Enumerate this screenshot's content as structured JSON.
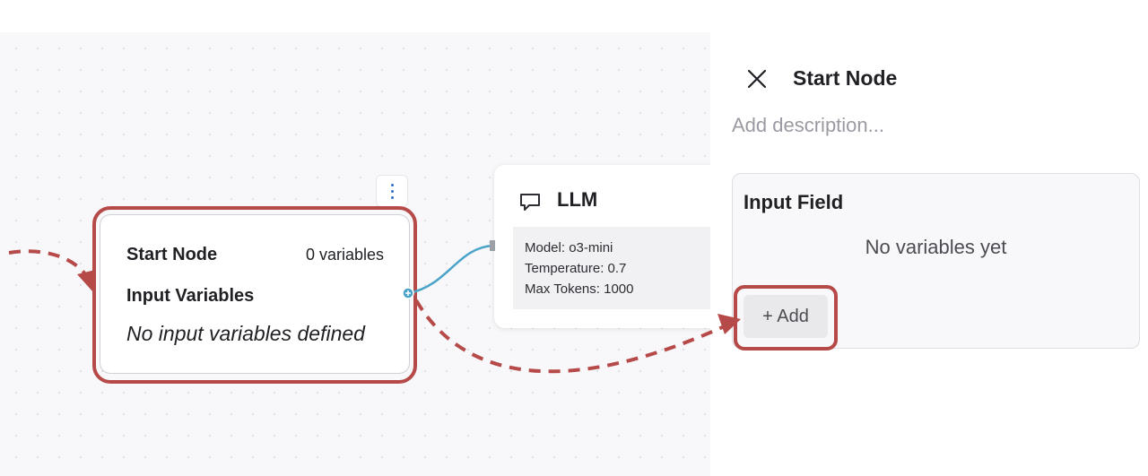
{
  "start_node": {
    "title": "Start Node",
    "variable_count": "0 variables",
    "section_label": "Input Variables",
    "empty_text": "No input variables defined"
  },
  "llm_node": {
    "title": "LLM",
    "icon": "chat-bubble-icon",
    "model": "Model: o3-mini",
    "temperature": "Temperature: 0.7",
    "max_tokens": "Max Tokens: 1000"
  },
  "panel": {
    "title": "Start Node",
    "description_placeholder": "Add description...",
    "input_field": {
      "title": "Input Field",
      "empty_text": "No variables yet",
      "add_label": "+ Add"
    }
  },
  "colors": {
    "highlight": "#b64a49",
    "edge": "#4aa3c8",
    "kebab_dots": "#2f6fd1"
  }
}
